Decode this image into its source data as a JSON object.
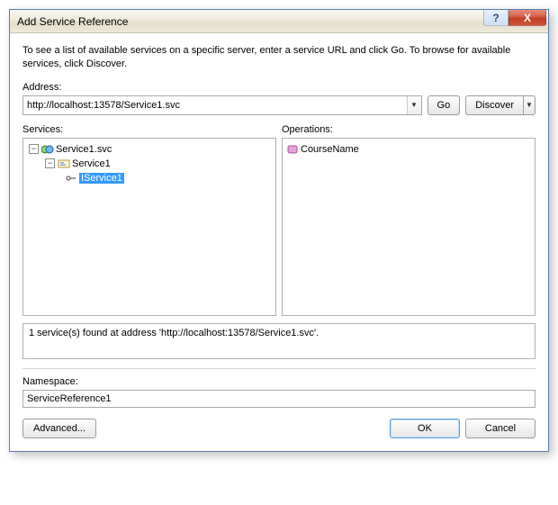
{
  "title": "Add Service Reference",
  "intro": "To see a list of available services on a specific server, enter a service URL and click Go. To browse for available services, click Discover.",
  "address": {
    "label": "Address:",
    "value": "http://localhost:13578/Service1.svc"
  },
  "buttons": {
    "go": "Go",
    "discover": "Discover",
    "advanced": "Advanced...",
    "ok": "OK",
    "cancel": "Cancel",
    "help": "?",
    "close": "X"
  },
  "services": {
    "label": "Services:",
    "tree": {
      "root": "Service1.svc",
      "child": "Service1",
      "leaf": "IService1"
    }
  },
  "operations": {
    "label": "Operations:",
    "items": [
      "CourseName"
    ]
  },
  "status": "1 service(s) found at address 'http://localhost:13578/Service1.svc'.",
  "namespace": {
    "label": "Namespace:",
    "value": "ServiceReference1"
  }
}
